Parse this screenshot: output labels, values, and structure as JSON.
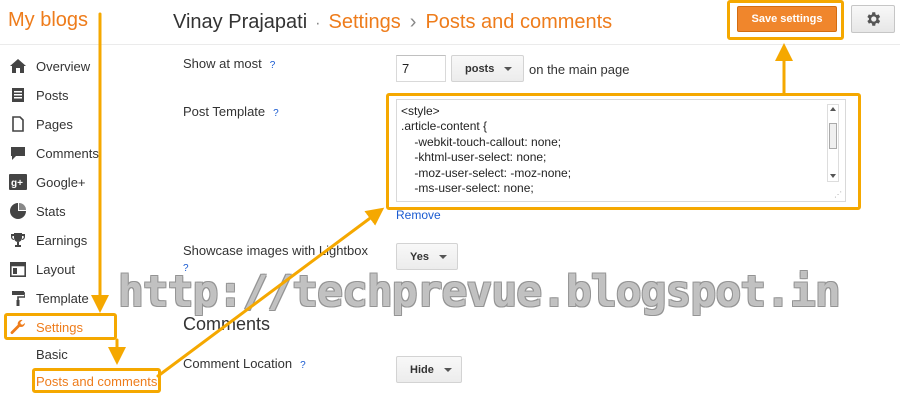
{
  "header": {
    "brand": "My blogs",
    "user": "Vinay Prajapati",
    "crumb_1": "Settings",
    "crumb_2": "Posts and comments",
    "save_label": "Save settings",
    "settings_icon": "gear-icon"
  },
  "sidebar": {
    "items": [
      {
        "label": "Overview",
        "icon": "home-icon"
      },
      {
        "label": "Posts",
        "icon": "posts-icon"
      },
      {
        "label": "Pages",
        "icon": "pages-icon"
      },
      {
        "label": "Comments",
        "icon": "comment-icon"
      },
      {
        "label": "Google+",
        "icon": "google-plus-icon"
      },
      {
        "label": "Stats",
        "icon": "stats-icon"
      },
      {
        "label": "Earnings",
        "icon": "trophy-icon"
      },
      {
        "label": "Layout",
        "icon": "layout-icon"
      },
      {
        "label": "Template",
        "icon": "paint-roller-icon"
      },
      {
        "label": "Settings",
        "icon": "wrench-icon",
        "active": true
      }
    ],
    "sub_items": [
      {
        "label": "Basic"
      },
      {
        "label": "Posts and comments",
        "active": true
      }
    ]
  },
  "main": {
    "show_at_most_label": "Show at most",
    "show_at_most_value": "7",
    "posts_dropdown": "posts",
    "on_main_page": "on the main page",
    "post_template_label": "Post Template",
    "post_template_lines": [
      "<style>",
      ".article-content {",
      "    -webkit-touch-callout: none;",
      "    -khtml-user-select: none;",
      "    -moz-user-select: -moz-none;",
      "    -ms-user-select: none;"
    ],
    "remove_link": "Remove",
    "lightbox_label": "Showcase images with Lightbox",
    "lightbox_value": "Yes",
    "comments_section": "Comments",
    "comment_location_label": "Comment Location",
    "comment_location_value": "Hide",
    "help_mark": "?"
  },
  "watermark": "http://techprevue.blogspot.in",
  "colors": {
    "accent": "#ee7c1b",
    "save_button": "#f0862c",
    "highlight": "#f5a800",
    "link": "#1a5bd1"
  }
}
